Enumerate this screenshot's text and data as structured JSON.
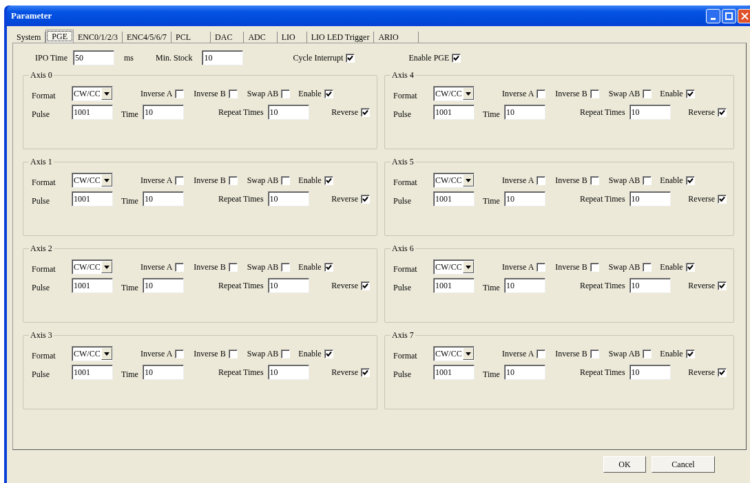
{
  "window": {
    "title": "Parameter"
  },
  "tabs": [
    {
      "label": "System",
      "selected": false
    },
    {
      "label": "PGE",
      "selected": true
    },
    {
      "label": "ENC0/1/2/3",
      "selected": false
    },
    {
      "label": "ENC4/5/6/7",
      "selected": false
    },
    {
      "label": "PCL",
      "selected": false
    },
    {
      "label": "DAC",
      "selected": false
    },
    {
      "label": "ADC",
      "selected": false
    },
    {
      "label": "LIO",
      "selected": false
    },
    {
      "label": "LIO LED Trigger",
      "selected": false
    },
    {
      "label": "ARIO",
      "selected": false
    }
  ],
  "general": {
    "ipo_label": "IPO Time",
    "ipo_value": "50",
    "ipo_unit": "ms",
    "stock_label": "Min. Stock",
    "stock_value": "10",
    "cycle_interrupt": {
      "label": "Cycle Interrupt",
      "checked": true
    },
    "enable_pge": {
      "label": "Enable PGE",
      "checked": true
    }
  },
  "axes": [
    {
      "title": "Axis 0",
      "format_label": "Format",
      "format": "CW/CC",
      "checks": [
        {
          "label": "Inverse A",
          "checked": false
        },
        {
          "label": "Inverse B",
          "checked": false
        },
        {
          "label": "Swap AB",
          "checked": false
        },
        {
          "label": "Enable",
          "checked": true
        }
      ],
      "pulse_label": "Pulse",
      "pulse": "1001",
      "time_label": "Time",
      "time": "10",
      "repeat_label": "Repeat Times",
      "repeat": "10",
      "reverse": {
        "label": "Reverse",
        "checked": true
      }
    },
    {
      "title": "Axis 4",
      "format_label": "Format",
      "format": "CW/CC",
      "checks": [
        {
          "label": "Inverse A",
          "checked": false
        },
        {
          "label": "Inverse B",
          "checked": false
        },
        {
          "label": "Swap AB",
          "checked": false
        },
        {
          "label": "Enable",
          "checked": true
        }
      ],
      "pulse_label": "Pulse",
      "pulse": "1001",
      "time_label": "Time",
      "time": "10",
      "repeat_label": "Repeat Times",
      "repeat": "10",
      "reverse": {
        "label": "Reverse",
        "checked": true
      }
    },
    {
      "title": "Axis 1",
      "format_label": "Format",
      "format": "CW/CC",
      "checks": [
        {
          "label": "Inverse A",
          "checked": false
        },
        {
          "label": "Inverse B",
          "checked": false
        },
        {
          "label": "Swap AB",
          "checked": false
        },
        {
          "label": "Enable",
          "checked": true
        }
      ],
      "pulse_label": "Pulse",
      "pulse": "1001",
      "time_label": "Time",
      "time": "10",
      "repeat_label": "Repeat Times",
      "repeat": "10",
      "reverse": {
        "label": "Reverse",
        "checked": true
      }
    },
    {
      "title": "Axis 5",
      "format_label": "Format",
      "format": "CW/CC",
      "checks": [
        {
          "label": "Inverse A",
          "checked": false
        },
        {
          "label": "Inverse B",
          "checked": false
        },
        {
          "label": "Swap AB",
          "checked": false
        },
        {
          "label": "Enable",
          "checked": true
        }
      ],
      "pulse_label": "Pulse",
      "pulse": "1001",
      "time_label": "Time",
      "time": "10",
      "repeat_label": "Repeat Times",
      "repeat": "10",
      "reverse": {
        "label": "Reverse",
        "checked": true
      }
    },
    {
      "title": "Axis 2",
      "format_label": "Format",
      "format": "CW/CC",
      "checks": [
        {
          "label": "Inverse A",
          "checked": false
        },
        {
          "label": "Inverse B",
          "checked": false
        },
        {
          "label": "Swap AB",
          "checked": false
        },
        {
          "label": "Enable",
          "checked": true
        }
      ],
      "pulse_label": "Pulse",
      "pulse": "1001",
      "time_label": "Time",
      "time": "10",
      "repeat_label": "Repeat Times",
      "repeat": "10",
      "reverse": {
        "label": "Reverse",
        "checked": true
      }
    },
    {
      "title": "Axis 6",
      "format_label": "Format",
      "format": "CW/CC",
      "checks": [
        {
          "label": "Inverse A",
          "checked": false
        },
        {
          "label": "Inverse B",
          "checked": false
        },
        {
          "label": "Swap AB",
          "checked": false
        },
        {
          "label": "Enable",
          "checked": true
        }
      ],
      "pulse_label": "Pulse",
      "pulse": "1001",
      "time_label": "Time",
      "time": "10",
      "repeat_label": "Repeat Times",
      "repeat": "10",
      "reverse": {
        "label": "Reverse",
        "checked": true
      }
    },
    {
      "title": "Axis 3",
      "format_label": "Format",
      "format": "CW/CC",
      "checks": [
        {
          "label": "Inverse A",
          "checked": false
        },
        {
          "label": "Inverse B",
          "checked": false
        },
        {
          "label": "Swap AB",
          "checked": false
        },
        {
          "label": "Enable",
          "checked": true
        }
      ],
      "pulse_label": "Pulse",
      "pulse": "1001",
      "time_label": "Time",
      "time": "10",
      "repeat_label": "Repeat Times",
      "repeat": "10",
      "reverse": {
        "label": "Reverse",
        "checked": true
      }
    },
    {
      "title": "Axis 7",
      "format_label": "Format",
      "format": "CW/CC",
      "checks": [
        {
          "label": "Inverse A",
          "checked": false
        },
        {
          "label": "Inverse B",
          "checked": false
        },
        {
          "label": "Swap AB",
          "checked": false
        },
        {
          "label": "Enable",
          "checked": true
        }
      ],
      "pulse_label": "Pulse",
      "pulse": "1001",
      "time_label": "Time",
      "time": "10",
      "repeat_label": "Repeat Times",
      "repeat": "10",
      "reverse": {
        "label": "Reverse",
        "checked": true
      }
    }
  ],
  "buttons": [
    "OK",
    "Cancel"
  ]
}
